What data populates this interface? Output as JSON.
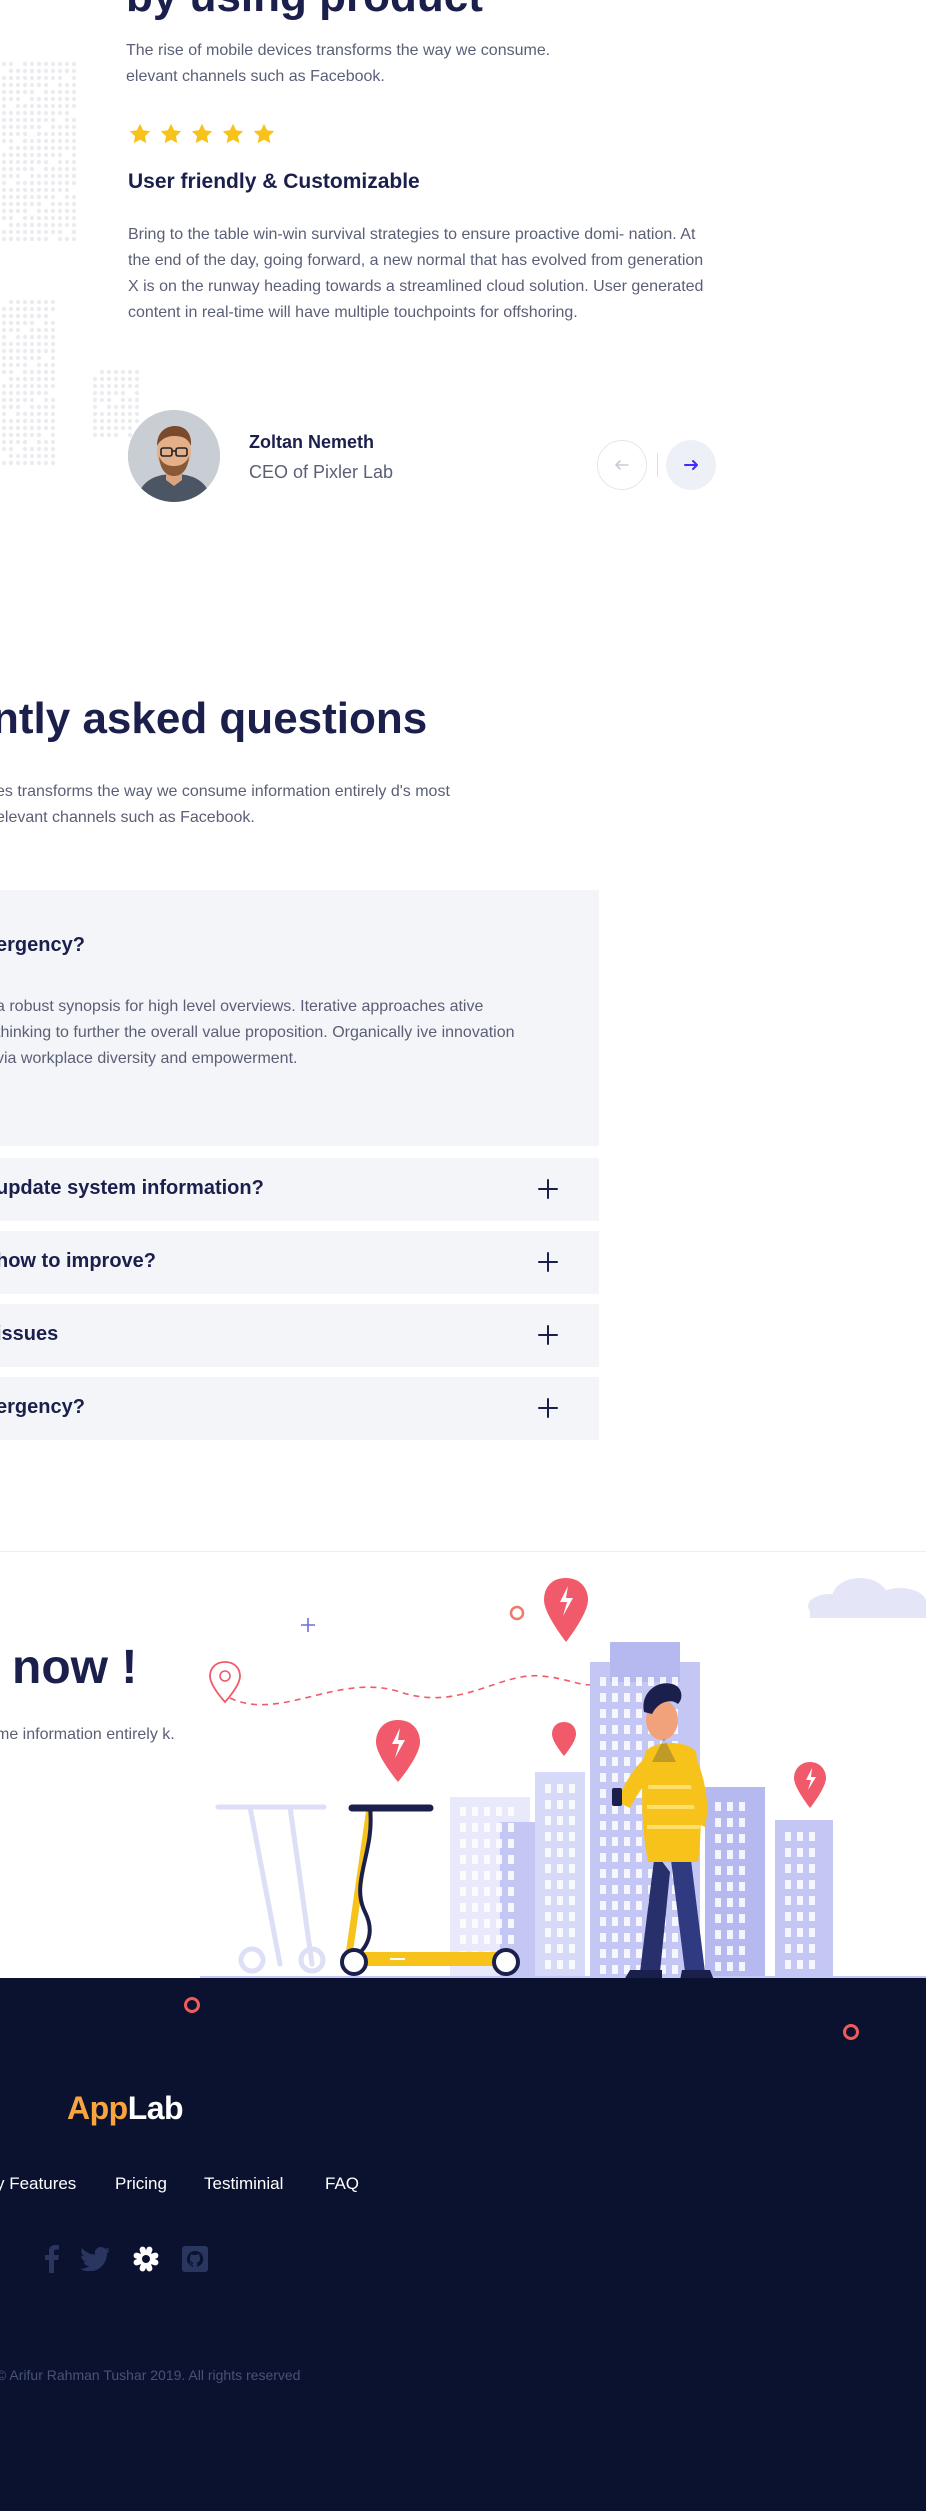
{
  "testimonial": {
    "heading": "by using product",
    "subtitle": "The rise of mobile devices transforms the way we consume.\nelevant channels such as Facebook.",
    "rating": 5,
    "star_color": "#f7c31b",
    "title": "User friendly & Customizable",
    "body": "Bring to the table win-win survival strategies to ensure proactive domi- nation. At the end of the day, going forward, a new normal that has evolved from generation X is on the runway heading towards a streamlined cloud solution. User generated content in real-time will have multiple touchpoints for offshoring.",
    "person_name": "Zoltan Nemeth",
    "person_role": "CEO of Pixler Lab",
    "prev_icon": "arrow-left-icon",
    "next_icon": "arrow-right-icon",
    "accent": "#3d2bff"
  },
  "faq": {
    "heading": "ntly asked questions",
    "subtitle": "es transforms the way we consume information entirely d's most elevant channels such as Facebook.",
    "open_item": {
      "question": "ergency?",
      "answer": "a robust synopsis for high level overviews. Iterative approaches ative thinking to further the overall value proposition. Organically ive innovation via workplace diversity and empowerment."
    },
    "items": [
      {
        "question": "update system information?"
      },
      {
        "question": "how to improve?"
      },
      {
        "question": "issues"
      },
      {
        "question": "ergency?"
      }
    ],
    "expand_icon": "plus-icon"
  },
  "cta": {
    "heading": "now !",
    "subtitle": "me information entirely k."
  },
  "footer": {
    "logo_part1": "App",
    "logo_part2": "Lab",
    "nav": [
      "y Features",
      "Pricing",
      "Testiminial",
      "FAQ"
    ],
    "social": [
      "facebook-icon",
      "twitter-icon",
      "slack-icon",
      "github-icon"
    ],
    "copyright": "© Arifur Rahman Tushar 2019. All rights reserved",
    "bg_color": "#0b1230",
    "logo_accent": "#f9a43e"
  }
}
